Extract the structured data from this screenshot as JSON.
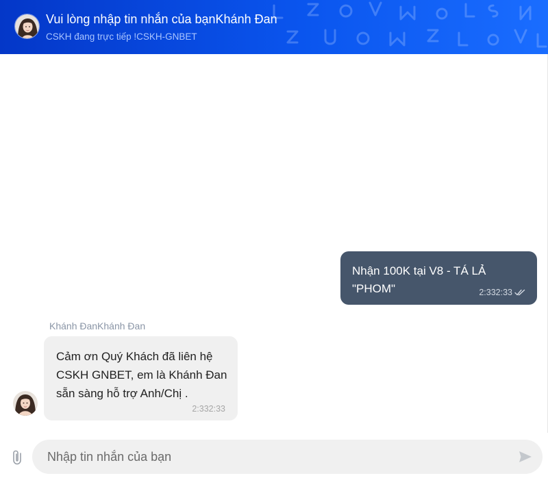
{
  "header": {
    "title": "Vui lòng nhập tin nhắn của bạnKhánh Đan",
    "subtitle": "CSKH đang trực tiếp !CSKH-GNBET",
    "pattern_letters": [
      "L",
      "Z",
      "O",
      "V",
      "M",
      "O",
      "L",
      "S",
      "N",
      "Z",
      "U",
      "O",
      "M",
      "Z",
      "L"
    ]
  },
  "messages": {
    "outgoing": {
      "text": "Nhận 100K tại V8 - TÁ LẢ \"PHOM\"",
      "time": "2:332:33"
    },
    "incoming": {
      "sender": "Khánh ĐanKhánh Đan",
      "text": "Cảm ơn Quý Khách đã liên hệ CSKH GNBET, em là Khánh Đan sẵn sàng hỗ trợ Anh/Chị .",
      "time": "2:332:33"
    }
  },
  "composer": {
    "placeholder": "Nhập tin nhắn của bạn"
  },
  "colors": {
    "header_start": "#0437c8",
    "header_end": "#1a6dff",
    "outgoing_bubble": "#46566b",
    "incoming_bubble": "#f0f0f0",
    "input_bg": "#f0f0f0"
  },
  "icons": {
    "attach": "paperclip-icon",
    "send": "send-icon",
    "read": "double-check-icon"
  }
}
